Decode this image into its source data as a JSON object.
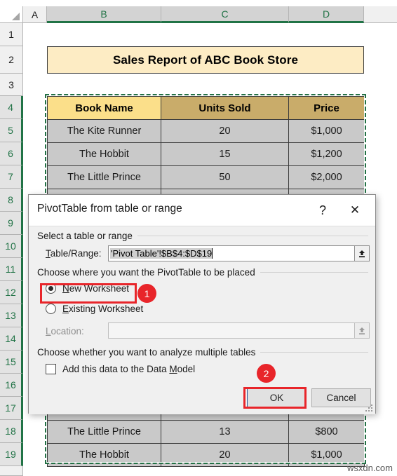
{
  "spreadsheet": {
    "column_headers": [
      "A",
      "B",
      "C",
      "D"
    ],
    "selected_columns": [
      "B",
      "C",
      "D"
    ],
    "row_headers": [
      "1",
      "2",
      "3",
      "4",
      "5",
      "6",
      "7",
      "8",
      "9",
      "10",
      "11",
      "12",
      "13",
      "14",
      "15",
      "16",
      "17",
      "18",
      "19"
    ],
    "selected_rows": [
      "4",
      "5",
      "6",
      "7",
      "8",
      "9",
      "10",
      "11",
      "12",
      "13",
      "14",
      "15",
      "16",
      "17",
      "18",
      "19"
    ],
    "title_banner": "Sales Report of ABC Book Store",
    "table": {
      "headers": [
        "Book Name",
        "Units Sold",
        "Price"
      ],
      "rows": [
        [
          "The Kite Runner",
          "20",
          "$1,000"
        ],
        [
          "The Hobbit",
          "15",
          "$1,200"
        ],
        [
          "The Little Prince",
          "50",
          "$2,000"
        ],
        [
          "",
          "",
          ""
        ],
        [
          "",
          "",
          ""
        ],
        [
          "",
          "",
          ""
        ],
        [
          "",
          "",
          ""
        ],
        [
          "",
          "",
          ""
        ],
        [
          "",
          "",
          ""
        ],
        [
          "",
          "",
          ""
        ],
        [
          "",
          "",
          ""
        ],
        [
          "",
          "",
          ""
        ],
        [
          "",
          "",
          ""
        ],
        [
          "The Little Prince",
          "13",
          "$800"
        ],
        [
          "The Hobbit",
          "20",
          "$1,000"
        ]
      ]
    },
    "colors": {
      "header_fill_first": "#fbdf8a",
      "header_fill": "#c9ac6a",
      "body_fill": "#c9c9c9",
      "title_fill": "#fdecc4",
      "selection_green": "#217346"
    }
  },
  "dialog": {
    "title": "PivotTable from table or range",
    "help_icon": "question-mark",
    "close_icon": "close-x",
    "group1_label": "Select a table or range",
    "table_range_label": "Table/Range:",
    "table_range_value": "'Pivot Table'!$B$4:$D$19",
    "collapse_icon": "collapse-dialog-arrow",
    "group2_label": "Choose where you want the PivotTable to be placed",
    "radio_new_worksheet": "New Worksheet",
    "radio_existing_worksheet": "Existing Worksheet",
    "radio_selected": "New Worksheet",
    "location_label": "Location:",
    "location_value": "",
    "group3_label": "Choose whether you want to analyze multiple tables",
    "checkbox_data_model": "Add this data to the Data Model",
    "checkbox_data_model_checked": false,
    "ok_label": "OK",
    "cancel_label": "Cancel"
  },
  "annotations": {
    "badge1": "1",
    "badge2": "2",
    "accent_color": "#e8252a"
  },
  "watermark": "wsxdn.com"
}
